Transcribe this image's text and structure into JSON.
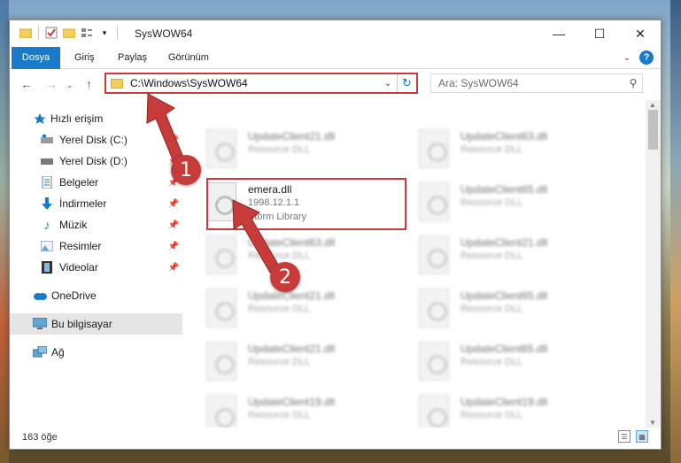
{
  "window": {
    "title": "SysWOW64"
  },
  "ribbon": {
    "tabs": [
      "Dosya",
      "Giriş",
      "Paylaş",
      "Görünüm"
    ]
  },
  "address": {
    "path": "C:\\Windows\\SysWOW64"
  },
  "search": {
    "placeholder": "Ara: SysWOW64"
  },
  "sidebar": {
    "items": [
      {
        "label": "Hızlı erişim",
        "icon": "star-icon",
        "pinned": false
      },
      {
        "label": "Yerel Disk (C:)",
        "icon": "drive-icon",
        "pinned": true
      },
      {
        "label": "Yerel Disk (D:)",
        "icon": "drive-icon",
        "pinned": true
      },
      {
        "label": "Belgeler",
        "icon": "documents-icon",
        "pinned": true
      },
      {
        "label": "İndirmeler",
        "icon": "download-icon",
        "pinned": true
      },
      {
        "label": "Müzik",
        "icon": "music-icon",
        "pinned": true
      },
      {
        "label": "Resimler",
        "icon": "pictures-icon",
        "pinned": true
      },
      {
        "label": "Videolar",
        "icon": "video-icon",
        "pinned": true
      },
      {
        "label": "OneDrive",
        "icon": "cloud-icon",
        "pinned": false
      },
      {
        "label": "Bu bilgisayar",
        "icon": "computer-icon",
        "pinned": false
      },
      {
        "label": "Ağ",
        "icon": "network-icon",
        "pinned": false
      }
    ]
  },
  "files": {
    "selected": {
      "name": "emera.dll",
      "version": "1998.12.1.1",
      "type": "Storm Library"
    },
    "left_column": [
      {
        "name": "UpdateClient21.dll",
        "type": "Resource DLL"
      },
      {
        "name": "UpdateClient63.dll",
        "type": "Resource DLL"
      },
      {
        "name": "UpdateClient21.dll",
        "type": "Resource DLL"
      },
      {
        "name": "UpdateClient21.dll",
        "type": "Resource DLL"
      },
      {
        "name": "UpdateClient19.dll",
        "type": "Resource DLL"
      }
    ],
    "right_column": [
      {
        "name": "UpdateClient63.dll",
        "type": "Resource DLL"
      },
      {
        "name": "UpdateClient65.dll",
        "type": "Resource DLL"
      },
      {
        "name": "UpdateClient21.dll",
        "type": "Resource DLL"
      },
      {
        "name": "UpdateClient65.dll",
        "type": "Resource DLL"
      },
      {
        "name": "UpdateClient65.dll",
        "type": "Resource DLL"
      },
      {
        "name": "UpdateClient19.dll",
        "type": "Resource DLL"
      }
    ]
  },
  "status": {
    "count": "163 öğe"
  },
  "callouts": {
    "one": "1",
    "two": "2"
  },
  "colors": {
    "accent": "#1979ca",
    "highlight": "#c83b3b"
  }
}
